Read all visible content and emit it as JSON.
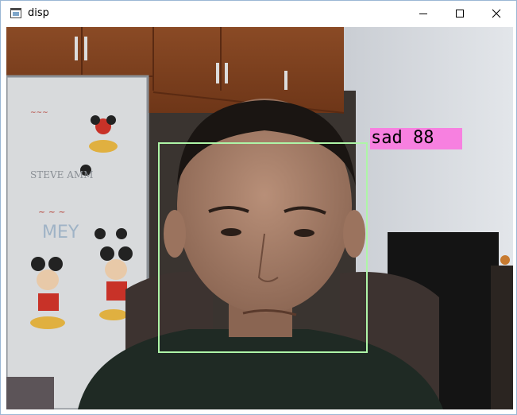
{
  "window": {
    "title": "disp",
    "icon": "app-window-icon",
    "controls": [
      "minimize-icon",
      "maximize-icon",
      "close-icon"
    ]
  },
  "detection": {
    "label": "sad 88",
    "box_color": "#aef5a7",
    "label_bg": "#f780e0"
  }
}
